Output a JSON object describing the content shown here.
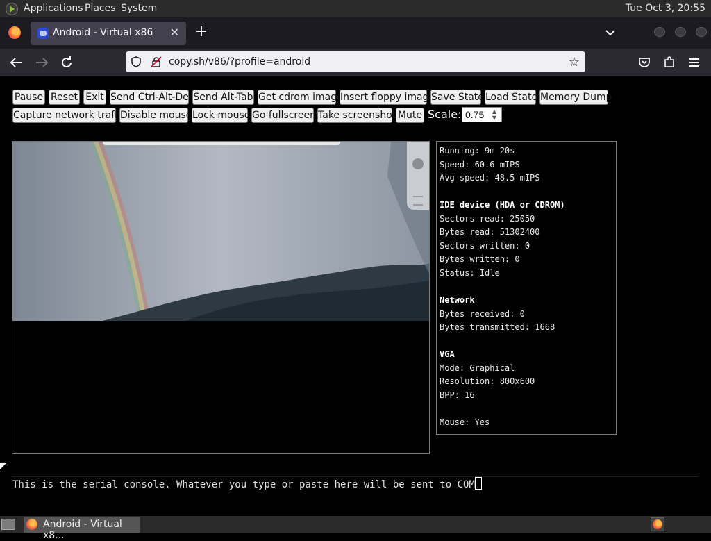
{
  "panel": {
    "menus": [
      "Applications",
      "Places",
      "System"
    ],
    "clock": "Tue Oct  3, 20:55"
  },
  "browser": {
    "tab_title": "Android - Virtual x86",
    "tab_close": "✕",
    "new_tab": "+",
    "url": "copy.sh/v86/?profile=android"
  },
  "toolbar": {
    "buttons": [
      "Pause",
      "Reset",
      "Exit",
      "Send Ctrl-Alt-Del",
      "Send Alt-Tab",
      "Get cdrom image",
      "Insert floppy image",
      "Save State",
      "Load State",
      "Memory Dump",
      "Capture network traffic",
      "Disable mouse",
      "Lock mouse",
      "Go fullscreen",
      "Take screenshot",
      "Mute"
    ],
    "scale_label": "Scale:",
    "scale_value": "0.75"
  },
  "stats": {
    "lines": [
      "Running: 9m 20s",
      "Speed: 60.6 mIPS",
      "Avg speed: 48.5 mIPS",
      "",
      "IDE device (HDA or CDROM)",
      "Sectors read: 25050",
      "Bytes read: 51302400",
      "Sectors written: 0",
      "Bytes written: 0",
      "Status: Idle",
      "",
      "Network",
      "Bytes received: 0",
      "Bytes transmitted: 1668",
      "",
      "VGA",
      "Mode: Graphical",
      "Resolution: 800x600",
      "BPP: 16",
      "",
      "Mouse: Yes"
    ]
  },
  "serial_console": {
    "text": "This is the serial console. Whatever you type or paste here will be sent to COM"
  },
  "taskbar": {
    "item": "Android - Virtual x8..."
  }
}
